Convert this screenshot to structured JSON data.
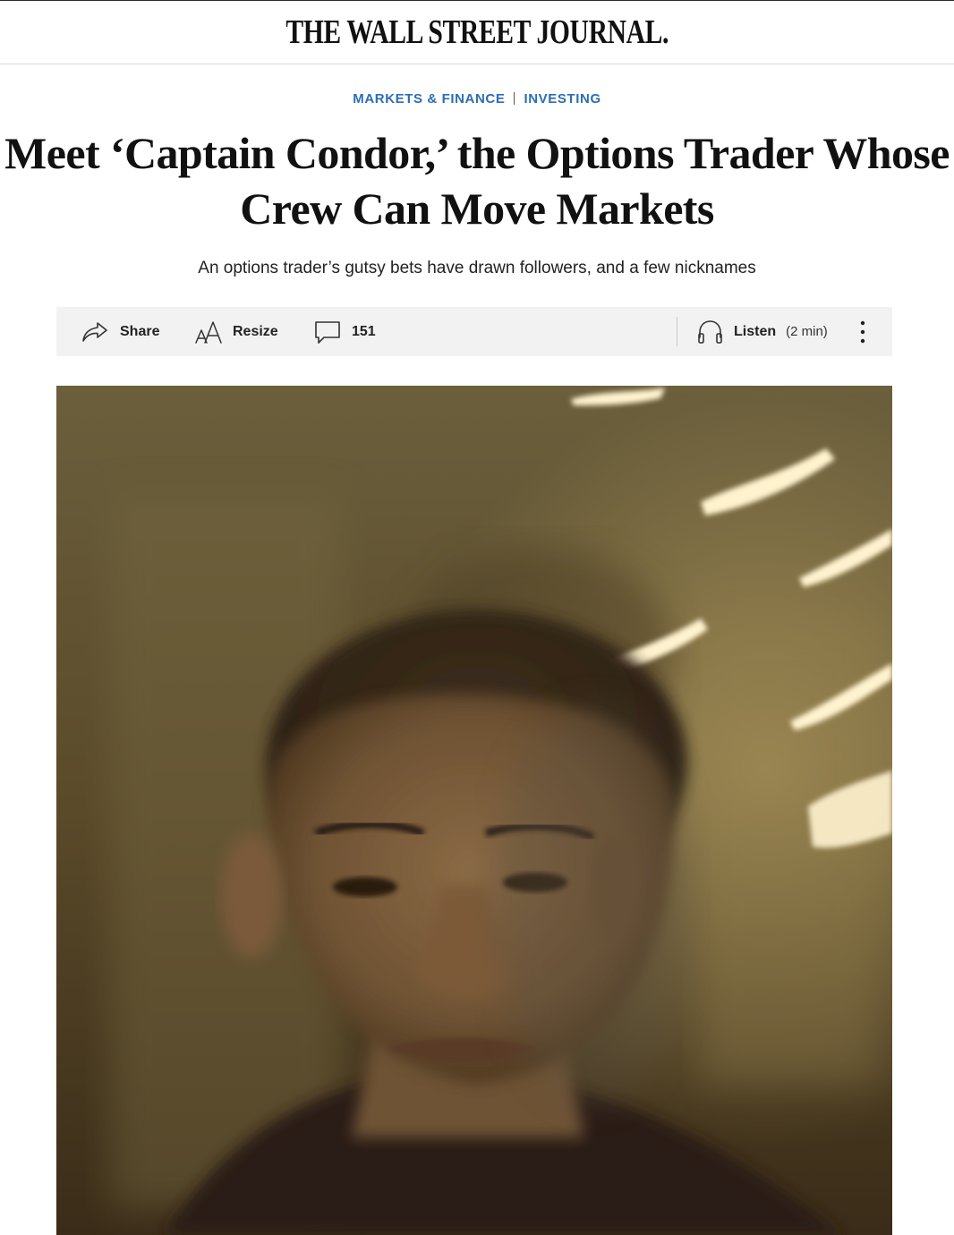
{
  "masthead": {
    "logo_text": "THE WALL STREET JOURNAL."
  },
  "breadcrumb": {
    "items": [
      {
        "label": "MARKETS & FINANCE"
      },
      {
        "label": "INVESTING"
      }
    ]
  },
  "article": {
    "headline_line1": "Meet ‘Captain Condor,’ the Options Trader Whose",
    "headline_line2": "Crew Can Move Markets",
    "dek": "An options trader’s gutsy bets have drawn followers, and a few nicknames"
  },
  "toolbar": {
    "share_label": "Share",
    "resize_label": "Resize",
    "comment_count": "151",
    "listen_label": "Listen",
    "listen_duration": "(2 min)"
  },
  "icons": {
    "share": "share-arrow-icon",
    "resize": "text-resize-icon",
    "comments": "speech-bubble-icon",
    "listen": "headphones-icon",
    "more": "vertical-ellipsis-icon"
  },
  "colors": {
    "section_link": "#2a6eb5",
    "toolbar_bg": "#f2f2f2",
    "text": "#111111"
  }
}
